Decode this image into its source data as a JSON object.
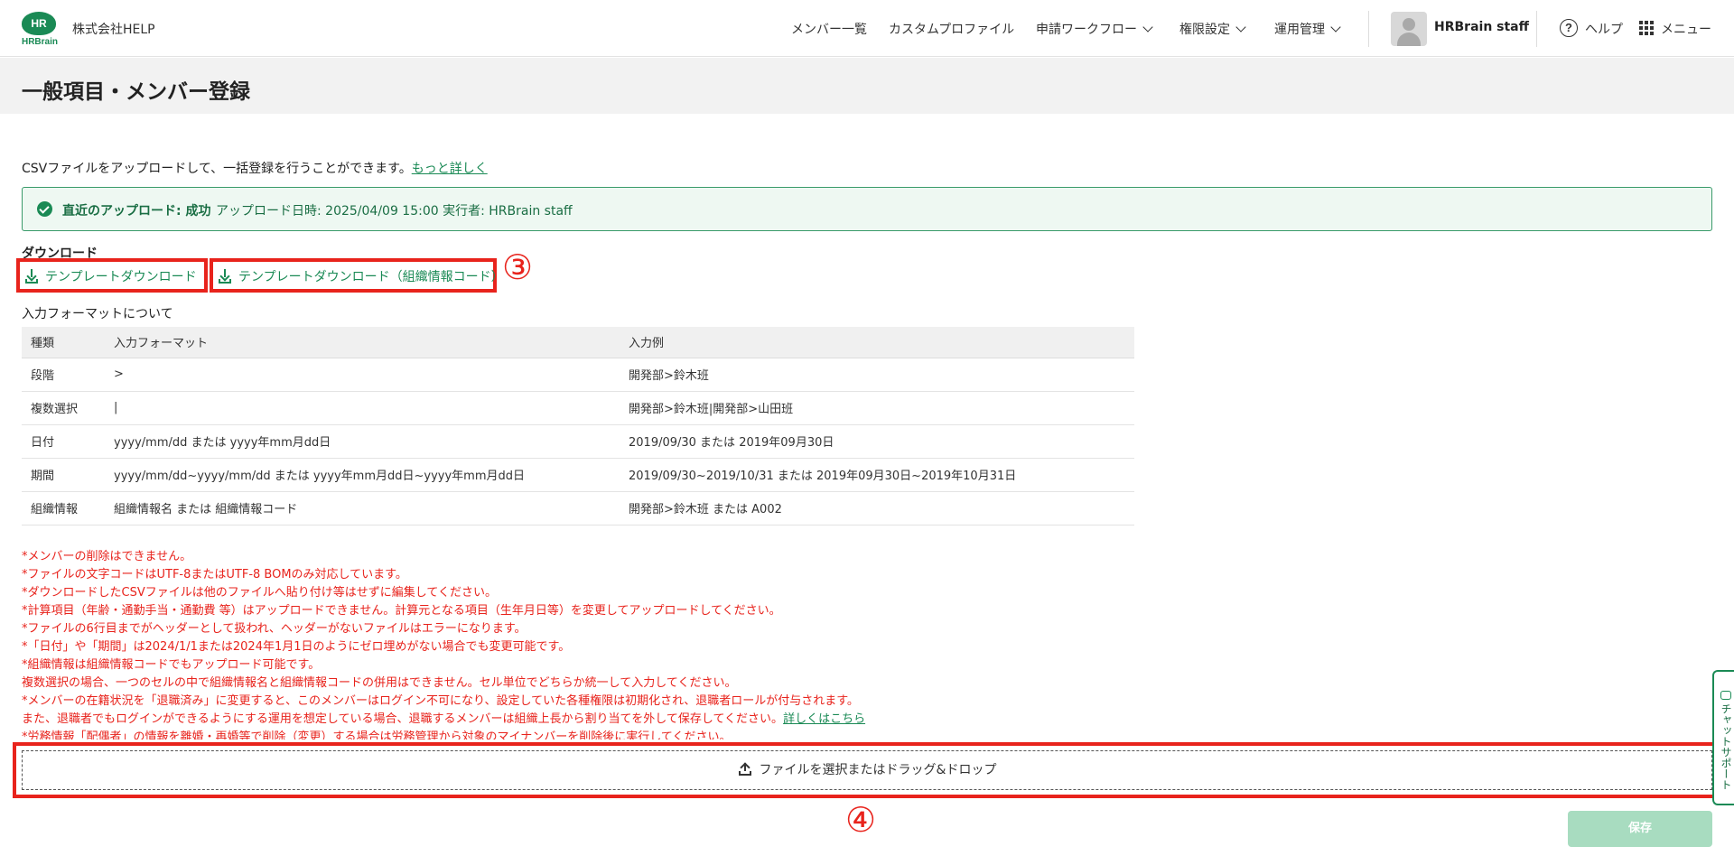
{
  "header": {
    "logo_mark": "HR",
    "logo_brand": "HRBrain",
    "company": "株式会社HELP",
    "nav": {
      "members": "メンバー一覧",
      "custom_profile": "カスタムプロファイル",
      "workflow": "申請ワークフロー",
      "permissions": "権限設定",
      "operations": "運用管理"
    },
    "user": "HRBrain staff",
    "help": "ヘルプ",
    "menu": "メニュー"
  },
  "page": {
    "title": "一般項目・メンバー登録"
  },
  "intro": {
    "text": "CSVファイルをアップロードして、一括登録を行うことができます。",
    "link": "もっと詳しく"
  },
  "success_banner": {
    "status": "直近のアップロード: 成功",
    "detail": "アップロード日時: 2025/04/09 15:00  実行者: HRBrain staff"
  },
  "download": {
    "heading": "ダウンロード",
    "template_label": "テンプレートダウンロード",
    "template_org_label": "テンプレートダウンロード（組織情報コード）"
  },
  "annotations": {
    "step3": "③",
    "step4": "④"
  },
  "format": {
    "heading": "入力フォーマットについて",
    "columns": [
      "種類",
      "入力フォーマット",
      "入力例"
    ],
    "rows": [
      [
        "段階",
        ">",
        "開発部>鈴木班"
      ],
      [
        "複数選択",
        "|",
        "開発部>鈴木班|開発部>山田班"
      ],
      [
        "日付",
        "yyyy/mm/dd または yyyy年mm月dd日",
        "2019/09/30 または 2019年09月30日"
      ],
      [
        "期間",
        "yyyy/mm/dd~yyyy/mm/dd または yyyy年mm月dd日~yyyy年mm月dd日",
        "2019/09/30~2019/10/31 または 2019年09月30日~2019年10月31日"
      ],
      [
        "組織情報",
        "組織情報名 または 組織情報コード",
        "開発部>鈴木班 または A002"
      ]
    ]
  },
  "notes": [
    "*メンバーの削除はできません。",
    "*ファイルの文字コードはUTF-8またはUTF-8 BOMのみ対応しています。",
    "*ダウンロードしたCSVファイルは他のファイルへ貼り付け等はせずに編集してください。",
    "*計算項目（年齢・通勤手当・通勤費 等）はアップロードできません。計算元となる項目（生年月日等）を変更してアップロードしてください。",
    "*ファイルの6行目までがヘッダーとして扱われ、ヘッダーがないファイルはエラーになります。",
    "*「日付」や「期間」は2024/1/1または2024年1月1日のようにゼロ埋めがない場合でも変更可能です。",
    "*組織情報は組織情報コードでもアップロード可能です。",
    "複数選択の場合、一つのセルの中で組織情報名と組織情報コードの併用はできません。セル単位でどちらか統一して入力してください。",
    "*メンバーの在籍状況を「退職済み」に変更すると、このメンバーはログイン不可になり、設定していた各種権限は初期化され、退職者ロールが付与されます。",
    "また、退職者でもログインができるようにする運用を想定している場合、退職するメンバーは組織上長から割り当てを外して保存してください。",
    "*労務情報「配偶者」の情報を離婚・再婚等で削除（変更）する場合は労務管理から対象のマイナンバーを削除後に実行してください。"
  ],
  "notes_link": "詳しくはこちら",
  "upload": {
    "label": "ファイルを選択またはドラッグ&ドロップ"
  },
  "save_label": "保存",
  "chat_support": "チャットサポート",
  "colors": {
    "brand_green": "#1a8a55",
    "annotation_red": "#e8231c",
    "notes_red": "#e8231c"
  }
}
